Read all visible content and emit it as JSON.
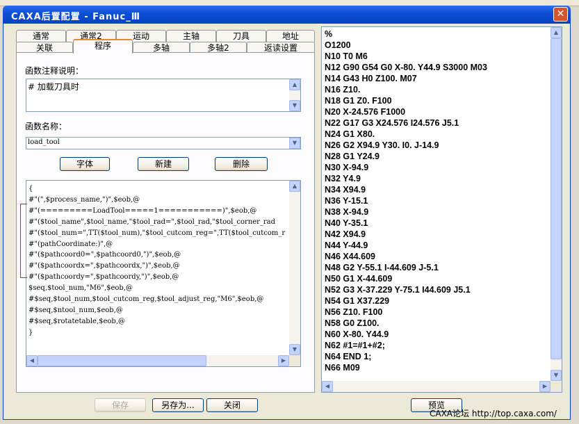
{
  "window": {
    "title": "CAXA后置配置 - Fanuc_Ⅲ",
    "close_label": "✕"
  },
  "tabs": {
    "row1": [
      "通常",
      "通常2",
      "运动",
      "主轴",
      "刀具",
      "地址"
    ],
    "row2": [
      "关联",
      "程序",
      "多轴",
      "多轴2",
      "返读设置"
    ],
    "active": "程序"
  },
  "func_note": {
    "label": "函数注释说明：",
    "value": "# 加载刀具时"
  },
  "func_name": {
    "label": "函数名称：",
    "value": "load_tool"
  },
  "buttons": {
    "font": "字体",
    "new": "新建",
    "delete": "删除",
    "save": "保存",
    "save_as": "另存为...",
    "close": "关闭",
    "preview": "预览"
  },
  "code_lines": [
    "{",
    "#\"(\",$process_name,\")\",$eob,@",
    "#\"(=========LoadTool=====1===========)\",$eob,@",
    "#\"($tool_name\",$tool_name,\"$tool_rad=\",$tool_rad,\"$tool_corner_rad",
    "#\"($tool_num=\",TT($tool_num),\"$tool_cutcom_reg=\",TT($tool_cutcom_r",
    "#\"(pathCoordinate:)\",@",
    "#\"($pathcoord0=\",$pathcoord0,\")\",$eob,@",
    "#\"($pathcoordx=\",$pathcoordx,\")\",$eob,@",
    "#\"($pathcoordy=\",$pathcoordy,\")\",$eob,@",
    "$seq,$tool_num,\"M6\",$eob,@",
    "#$seq,$tool_num,$tool_cutcom_reg,$tool_adjust_reg,\"M6\",$eob,@",
    "#$seq,$ntool_num,$eob,@",
    "#$seq,$rotatetable,$eob,@",
    "}"
  ],
  "nc_lines": [
    "%",
    "O1200",
    "N10 T0 M6",
    "N12 G90 G54 G0 X-80. Y44.9 S3000 M03",
    "N14 G43 H0 Z100. M07",
    "N16 Z10.",
    "N18 G1 Z0. F100",
    "N20 X-24.576 F1000",
    "N22 G17 G3 X24.576 I24.576 J5.1",
    "N24 G1 X80.",
    "N26 G2 X94.9 Y30. I0. J-14.9",
    "N28 G1 Y24.9",
    "N30 X-94.9",
    "N32 Y4.9",
    "N34 X94.9",
    "N36 Y-15.1",
    "N38 X-94.9",
    "N40 Y-35.1",
    "N42 X94.9",
    "N44 Y-44.9",
    "N46 X44.609",
    "N48 G2 Y-55.1 I-44.609 J-5.1",
    "N50 G1 X-44.609",
    "N52 G3 X-37.229 Y-75.1 I44.609 J5.1",
    "N54 G1 X37.229",
    "N56 Z10. F100",
    "N58 G0 Z100.",
    "N60 X-80. Y44.9",
    "N62 #1=#1+#2;",
    "N64 END 1;",
    "N66 M09"
  ],
  "watermark": "CAXA论坛 http://top.caxa.com/"
}
